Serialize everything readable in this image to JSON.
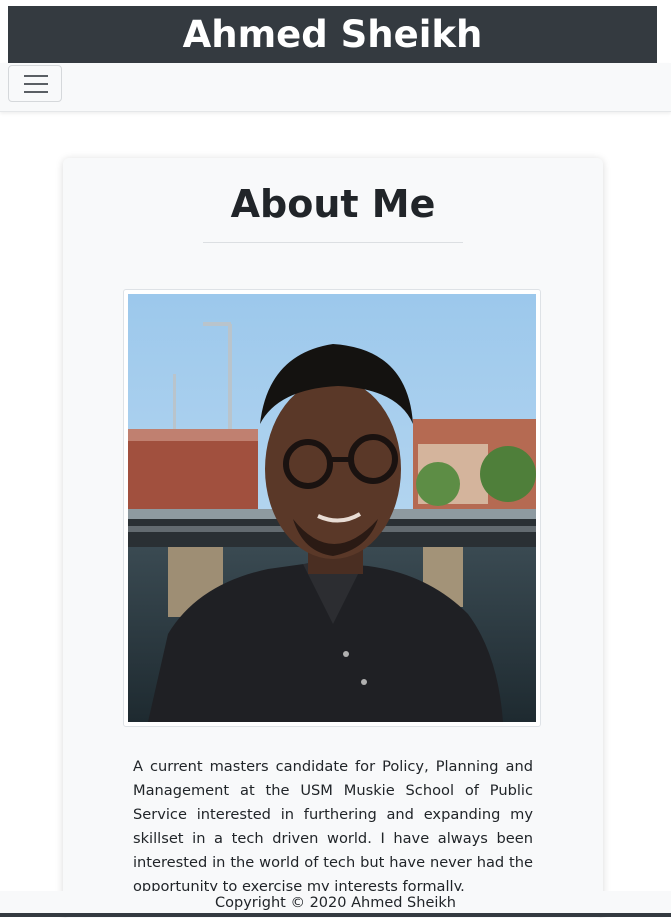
{
  "header": {
    "title": "Ahmed Sheikh"
  },
  "navbar": {
    "toggler_icon": "hamburger-menu-icon"
  },
  "about": {
    "title": "About Me",
    "photo_alt": "Ahmed Sheikh",
    "bio": "A current masters candidate for Policy, Planning and Management at the USM Muskie School of Public Service interested in furthering and expanding my skillset in a tech driven world. I have always been interested in the world of tech but have never had the opportunity to exercise my interests formally."
  },
  "footer": {
    "copyright": "Copyright © 2020 Ahmed Sheikh"
  },
  "colors": {
    "header_bg": "#343a40",
    "navbar_bg": "#f8f9fa",
    "card_bg": "#f8f9fa",
    "text": "#212529"
  }
}
